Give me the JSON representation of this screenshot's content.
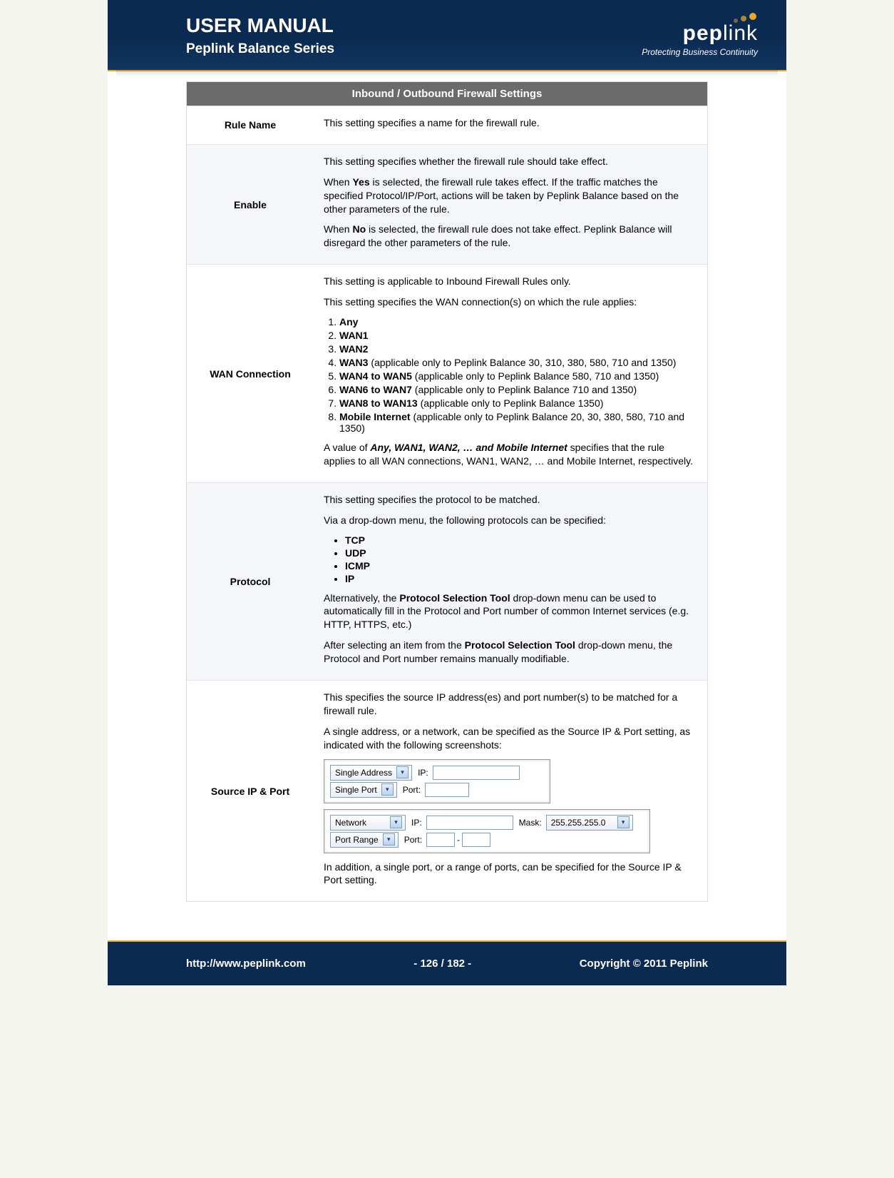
{
  "header": {
    "title": "USER MANUAL",
    "subtitle": "Peplink Balance Series",
    "logo_brand_prefix": "pep",
    "logo_brand_suffix": "link",
    "logo_tagline": "Protecting Business Continuity"
  },
  "table": {
    "heading": "Inbound / Outbound Firewall Settings",
    "rows": {
      "rule_name": {
        "label": "Rule Name",
        "p1": "This setting specifies a name for the firewall rule."
      },
      "enable": {
        "label": "Enable",
        "p1": "This setting specifies whether the firewall rule should take effect.",
        "p2a": "When ",
        "p2b": "Yes",
        "p2c": " is selected, the firewall rule takes effect.  If the traffic matches the specified Protocol/IP/Port, actions will be taken by Peplink Balance based on the other parameters of the rule.",
        "p3a": "When ",
        "p3b": "No",
        "p3c": " is selected, the firewall rule does not take effect.  Peplink Balance will disregard the other parameters of the rule."
      },
      "wan": {
        "label": "WAN Connection",
        "p1": "This setting is applicable to Inbound Firewall Rules only.",
        "p2": "This setting specifies the WAN connection(s) on which the rule applies:",
        "li1": "Any",
        "li2": "WAN1",
        "li3": "WAN2",
        "li4a": "WAN3",
        "li4b": " (applicable only to Peplink Balance 30, 310, 380, 580, 710 and 1350)",
        "li5a": "WAN4 to WAN5",
        "li5b": " (applicable only to Peplink Balance 580, 710 and 1350)",
        "li6a": "WAN6 to WAN7",
        "li6b": " (applicable only to Peplink Balance 710 and 1350)",
        "li7a": "WAN8 to WAN13",
        "li7b": " (applicable only to Peplink Balance 1350)",
        "li8a": "Mobile Internet",
        "li8b": " (applicable only to Peplink Balance 20, 30, 380, 580, 710 and 1350)",
        "p3a": "A value of ",
        "p3b": "Any, WAN1, WAN2, … and Mobile Internet",
        "p3c": " specifies that the rule applies to all WAN connections, WAN1, WAN2, … and Mobile Internet, respectively."
      },
      "protocol": {
        "label": "Protocol",
        "p1": "This setting specifies the protocol to be matched.",
        "p2": "Via a drop-down menu, the following protocols can be specified:",
        "li1": "TCP",
        "li2": "UDP",
        "li3": "ICMP",
        "li4": "IP",
        "p3a": "Alternatively, the ",
        "p3b": "Protocol Selection Tool",
        "p3c": " drop-down menu can be used to automatically fill in the Protocol and Port number of common Internet services (e.g. HTTP, HTTPS, etc.)",
        "p4a": "After selecting an item from the ",
        "p4b": "Protocol Selection Tool",
        "p4c": " drop-down menu, the Protocol and Port number remains manually modifiable."
      },
      "source": {
        "label": "Source IP & Port",
        "p1": "This specifies the source IP address(es) and port number(s) to be matched for a firewall rule.",
        "p2": "A single address, or a network, can be specified as the Source IP & Port setting, as indicated with the following screenshots:",
        "p3": "In addition, a single port, or a range of ports, can be specified for the Source IP & Port setting."
      }
    }
  },
  "screenshot_widgets": {
    "single_address": "Single Address",
    "single_port": "Single Port",
    "network": "Network",
    "port_range": "Port Range",
    "ip_label": "IP:",
    "port_label": "Port:",
    "mask_label": "Mask:",
    "mask_value": "255.255.255.0",
    "dash": "-"
  },
  "footer": {
    "url": "http://www.peplink.com",
    "page": "- 126 / 182 -",
    "copyright": "Copyright © 2011 Peplink"
  }
}
